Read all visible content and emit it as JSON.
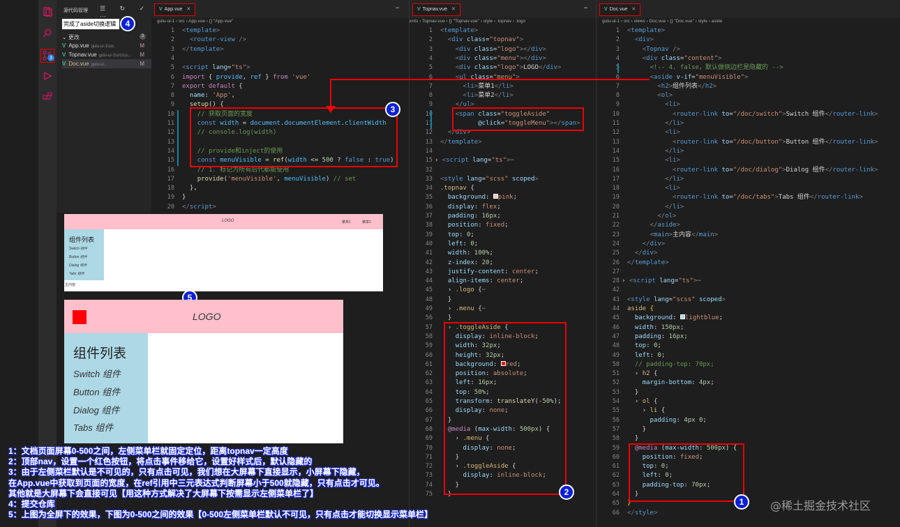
{
  "scm": {
    "title": "源代码管理",
    "tools": "☰ ↻ ✓ ⋯",
    "commit_message": "完成了aside切换逻辑",
    "changes_label": "更改",
    "changes_count": "3",
    "files": [
      {
        "name": "App.vue",
        "path": "gulu-ui-1\\src",
        "status": "M"
      },
      {
        "name": "Topnav.vue",
        "path": "gulu-ui-1\\src\\co...",
        "status": "M"
      },
      {
        "name": "Doc.vue",
        "path": "gulu-ui...",
        "status": "M"
      }
    ]
  },
  "activity_badge": "3",
  "panes": [
    {
      "tab": "App.vue",
      "crumb": "gulu-ui-1 › src › App.vue › {} \"App.vue\""
    },
    {
      "tab": "Topnav.vue",
      "crumb": "ents › Topnav.vue › {} \"Topnav.vue\" › style › .topnav › .logo"
    },
    {
      "tab": "Doc.vue",
      "crumb": "gulu-ui-1 › src › views › Doc.vue › {} \"Doc.vue\" › style › aside"
    }
  ],
  "icons": {
    "vue": "vue-icon",
    "close": "close-icon",
    "more": "more-icon"
  },
  "preview_small": {
    "logo": "LOGO",
    "menu1": "菜单1",
    "menu2": "菜单2",
    "aside_title": "组件列表",
    "items": [
      "Switch 组件",
      "Button 组件",
      "Dialog 组件",
      "Tabs 组件"
    ],
    "main": "主内容"
  },
  "preview_large": {
    "logo": "LOGO",
    "aside_title": "组件列表",
    "items": [
      "Switch 组件",
      "Button 组件",
      "Dialog 组件",
      "Tabs 组件"
    ]
  },
  "markers": [
    "1",
    "2",
    "3",
    "4",
    "5"
  ],
  "notes": [
    "1：文档页面屏幕0-500之间，左侧菜单栏就固定定位，距离topnav一定高度",
    "2：顶部nav，设置一个红色按钮，将点击事件移给它，设置好样式后，默认隐藏的",
    "3：由于左侧菜栏默认是不可见的，只有点击可见，我们想在大屏幕下直接显示，小屏幕下隐藏，",
    "在App.vue中获取到页面的宽度，在ref引用中三元表达式判断屏幕小于500就隐藏，只有点击才可见。",
    "其他就是大屏幕下会直接可见【用这种方式解决了大屏幕下按需显示左侧菜单栏了】",
    "4：提交仓库",
    "5：上图为全屏下的效果，下图为0-500之间的效果【0-500左侧菜单栏默认不可见，只有点击才能切换显示菜单栏】"
  ],
  "watermark": "@稀土掘金技术社区",
  "colors": {
    "accent": "#e00000",
    "marker": "#0b1fd6",
    "pink": "#ffc0cb",
    "lightblue": "#add8e6"
  }
}
